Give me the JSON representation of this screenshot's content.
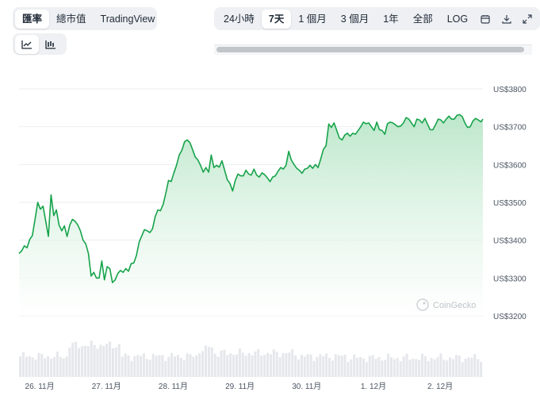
{
  "toolbar": {
    "metric_tabs": [
      {
        "label": "匯率",
        "active": true
      },
      {
        "label": "總市值",
        "active": false
      },
      {
        "label": "TradingView",
        "active": false
      }
    ],
    "chart_types": [
      {
        "icon": "line-chart-icon",
        "active": true
      },
      {
        "icon": "ohlc-chart-icon",
        "active": false
      }
    ],
    "ranges": [
      {
        "label": "24小時",
        "active": false
      },
      {
        "label": "7天",
        "active": true
      },
      {
        "label": "1 個月",
        "active": false
      },
      {
        "label": "3 個月",
        "active": false
      },
      {
        "label": "1年",
        "active": false
      },
      {
        "label": "全部",
        "active": false
      },
      {
        "label": "LOG",
        "active": false
      }
    ],
    "actions": [
      "calendar-icon",
      "download-icon",
      "expand-icon"
    ]
  },
  "watermark": "CoinGecko",
  "colors": {
    "line": "#16a34a",
    "area_top": "#b9e6c8",
    "volume": "#e5e7eb",
    "grid": "#eceef1"
  },
  "chart_data": {
    "type": "area",
    "title": "",
    "xlabel": "",
    "ylabel": "",
    "ylim": [
      3200,
      3800
    ],
    "yticks": [
      3200,
      3300,
      3400,
      3500,
      3600,
      3700,
      3800
    ],
    "ytick_labels": [
      "US$3200",
      "US$3300",
      "US$3400",
      "US$3500",
      "US$3600",
      "US$3700",
      "US$3800"
    ],
    "xlim_days": [
      0,
      6.95
    ],
    "xticks_days": [
      0.31,
      1.31,
      2.31,
      3.31,
      4.31,
      5.31,
      6.31
    ],
    "xtick_labels": [
      "26. 11月",
      "27. 11月",
      "28. 11月",
      "29. 11月",
      "30. 11月",
      "1. 12月",
      "2. 12月"
    ],
    "x_days": [
      0.0,
      0.04,
      0.08,
      0.12,
      0.16,
      0.2,
      0.24,
      0.28,
      0.32,
      0.36,
      0.4,
      0.44,
      0.48,
      0.52,
      0.56,
      0.6,
      0.64,
      0.68,
      0.72,
      0.76,
      0.8,
      0.84,
      0.88,
      0.92,
      0.96,
      1.0,
      1.04,
      1.08,
      1.12,
      1.16,
      1.2,
      1.24,
      1.28,
      1.32,
      1.36,
      1.4,
      1.44,
      1.48,
      1.52,
      1.56,
      1.6,
      1.64,
      1.68,
      1.72,
      1.76,
      1.8,
      1.84,
      1.88,
      1.92,
      1.96,
      2.0,
      2.04,
      2.08,
      2.12,
      2.16,
      2.2,
      2.24,
      2.28,
      2.32,
      2.36,
      2.4,
      2.44,
      2.48,
      2.52,
      2.56,
      2.6,
      2.64,
      2.68,
      2.72,
      2.76,
      2.8,
      2.84,
      2.88,
      2.92,
      2.96,
      3.0,
      3.04,
      3.08,
      3.12,
      3.16,
      3.2,
      3.24,
      3.28,
      3.32,
      3.36,
      3.4,
      3.44,
      3.48,
      3.52,
      3.56,
      3.6,
      3.64,
      3.68,
      3.72,
      3.76,
      3.8,
      3.84,
      3.88,
      3.92,
      3.96,
      4.0,
      4.04,
      4.08,
      4.12,
      4.16,
      4.2,
      4.24,
      4.28,
      4.32,
      4.36,
      4.4,
      4.44,
      4.48,
      4.52,
      4.56,
      4.6,
      4.64,
      4.68,
      4.72,
      4.76,
      4.8,
      4.84,
      4.88,
      4.92,
      4.96,
      5.0,
      5.04,
      5.08,
      5.12,
      5.16,
      5.2,
      5.24,
      5.28,
      5.32,
      5.36,
      5.4,
      5.44,
      5.48,
      5.52,
      5.56,
      5.6,
      5.64,
      5.68,
      5.72,
      5.76,
      5.8,
      5.84,
      5.88,
      5.92,
      5.96,
      6.0,
      6.04,
      6.08,
      6.12,
      6.16,
      6.2,
      6.24,
      6.28,
      6.32,
      6.36,
      6.4,
      6.44,
      6.48,
      6.52,
      6.56,
      6.6,
      6.64,
      6.68,
      6.72,
      6.76,
      6.8,
      6.84,
      6.88,
      6.92,
      6.95
    ],
    "y": [
      3365,
      3372,
      3385,
      3380,
      3402,
      3412,
      3455,
      3500,
      3482,
      3490,
      3450,
      3410,
      3520,
      3465,
      3480,
      3440,
      3425,
      3438,
      3410,
      3440,
      3455,
      3450,
      3440,
      3425,
      3400,
      3390,
      3365,
      3305,
      3315,
      3300,
      3300,
      3345,
      3295,
      3330,
      3325,
      3288,
      3295,
      3312,
      3320,
      3315,
      3325,
      3318,
      3338,
      3340,
      3360,
      3395,
      3412,
      3428,
      3425,
      3420,
      3430,
      3462,
      3480,
      3478,
      3495,
      3525,
      3558,
      3555,
      3578,
      3598,
      3625,
      3638,
      3660,
      3665,
      3658,
      3640,
      3620,
      3612,
      3598,
      3580,
      3592,
      3580,
      3625,
      3592,
      3598,
      3593,
      3610,
      3585,
      3560,
      3550,
      3530,
      3558,
      3575,
      3570,
      3570,
      3585,
      3575,
      3572,
      3588,
      3572,
      3567,
      3578,
      3573,
      3565,
      3555,
      3567,
      3570,
      3582,
      3592,
      3588,
      3598,
      3635,
      3612,
      3600,
      3590,
      3585,
      3577,
      3588,
      3590,
      3598,
      3590,
      3600,
      3592,
      3615,
      3640,
      3650,
      3707,
      3698,
      3710,
      3690,
      3670,
      3665,
      3678,
      3683,
      3675,
      3683,
      3680,
      3690,
      3700,
      3712,
      3708,
      3710,
      3700,
      3690,
      3712,
      3692,
      3690,
      3680,
      3708,
      3712,
      3710,
      3705,
      3700,
      3702,
      3710,
      3724,
      3720,
      3710,
      3700,
      3720,
      3718,
      3710,
      3722,
      3707,
      3692,
      3692,
      3705,
      3720,
      3718,
      3710,
      3720,
      3728,
      3720,
      3720,
      3730,
      3732,
      3727,
      3710,
      3698,
      3700,
      3715,
      3722,
      3718,
      3713,
      3720,
      3728
    ]
  }
}
